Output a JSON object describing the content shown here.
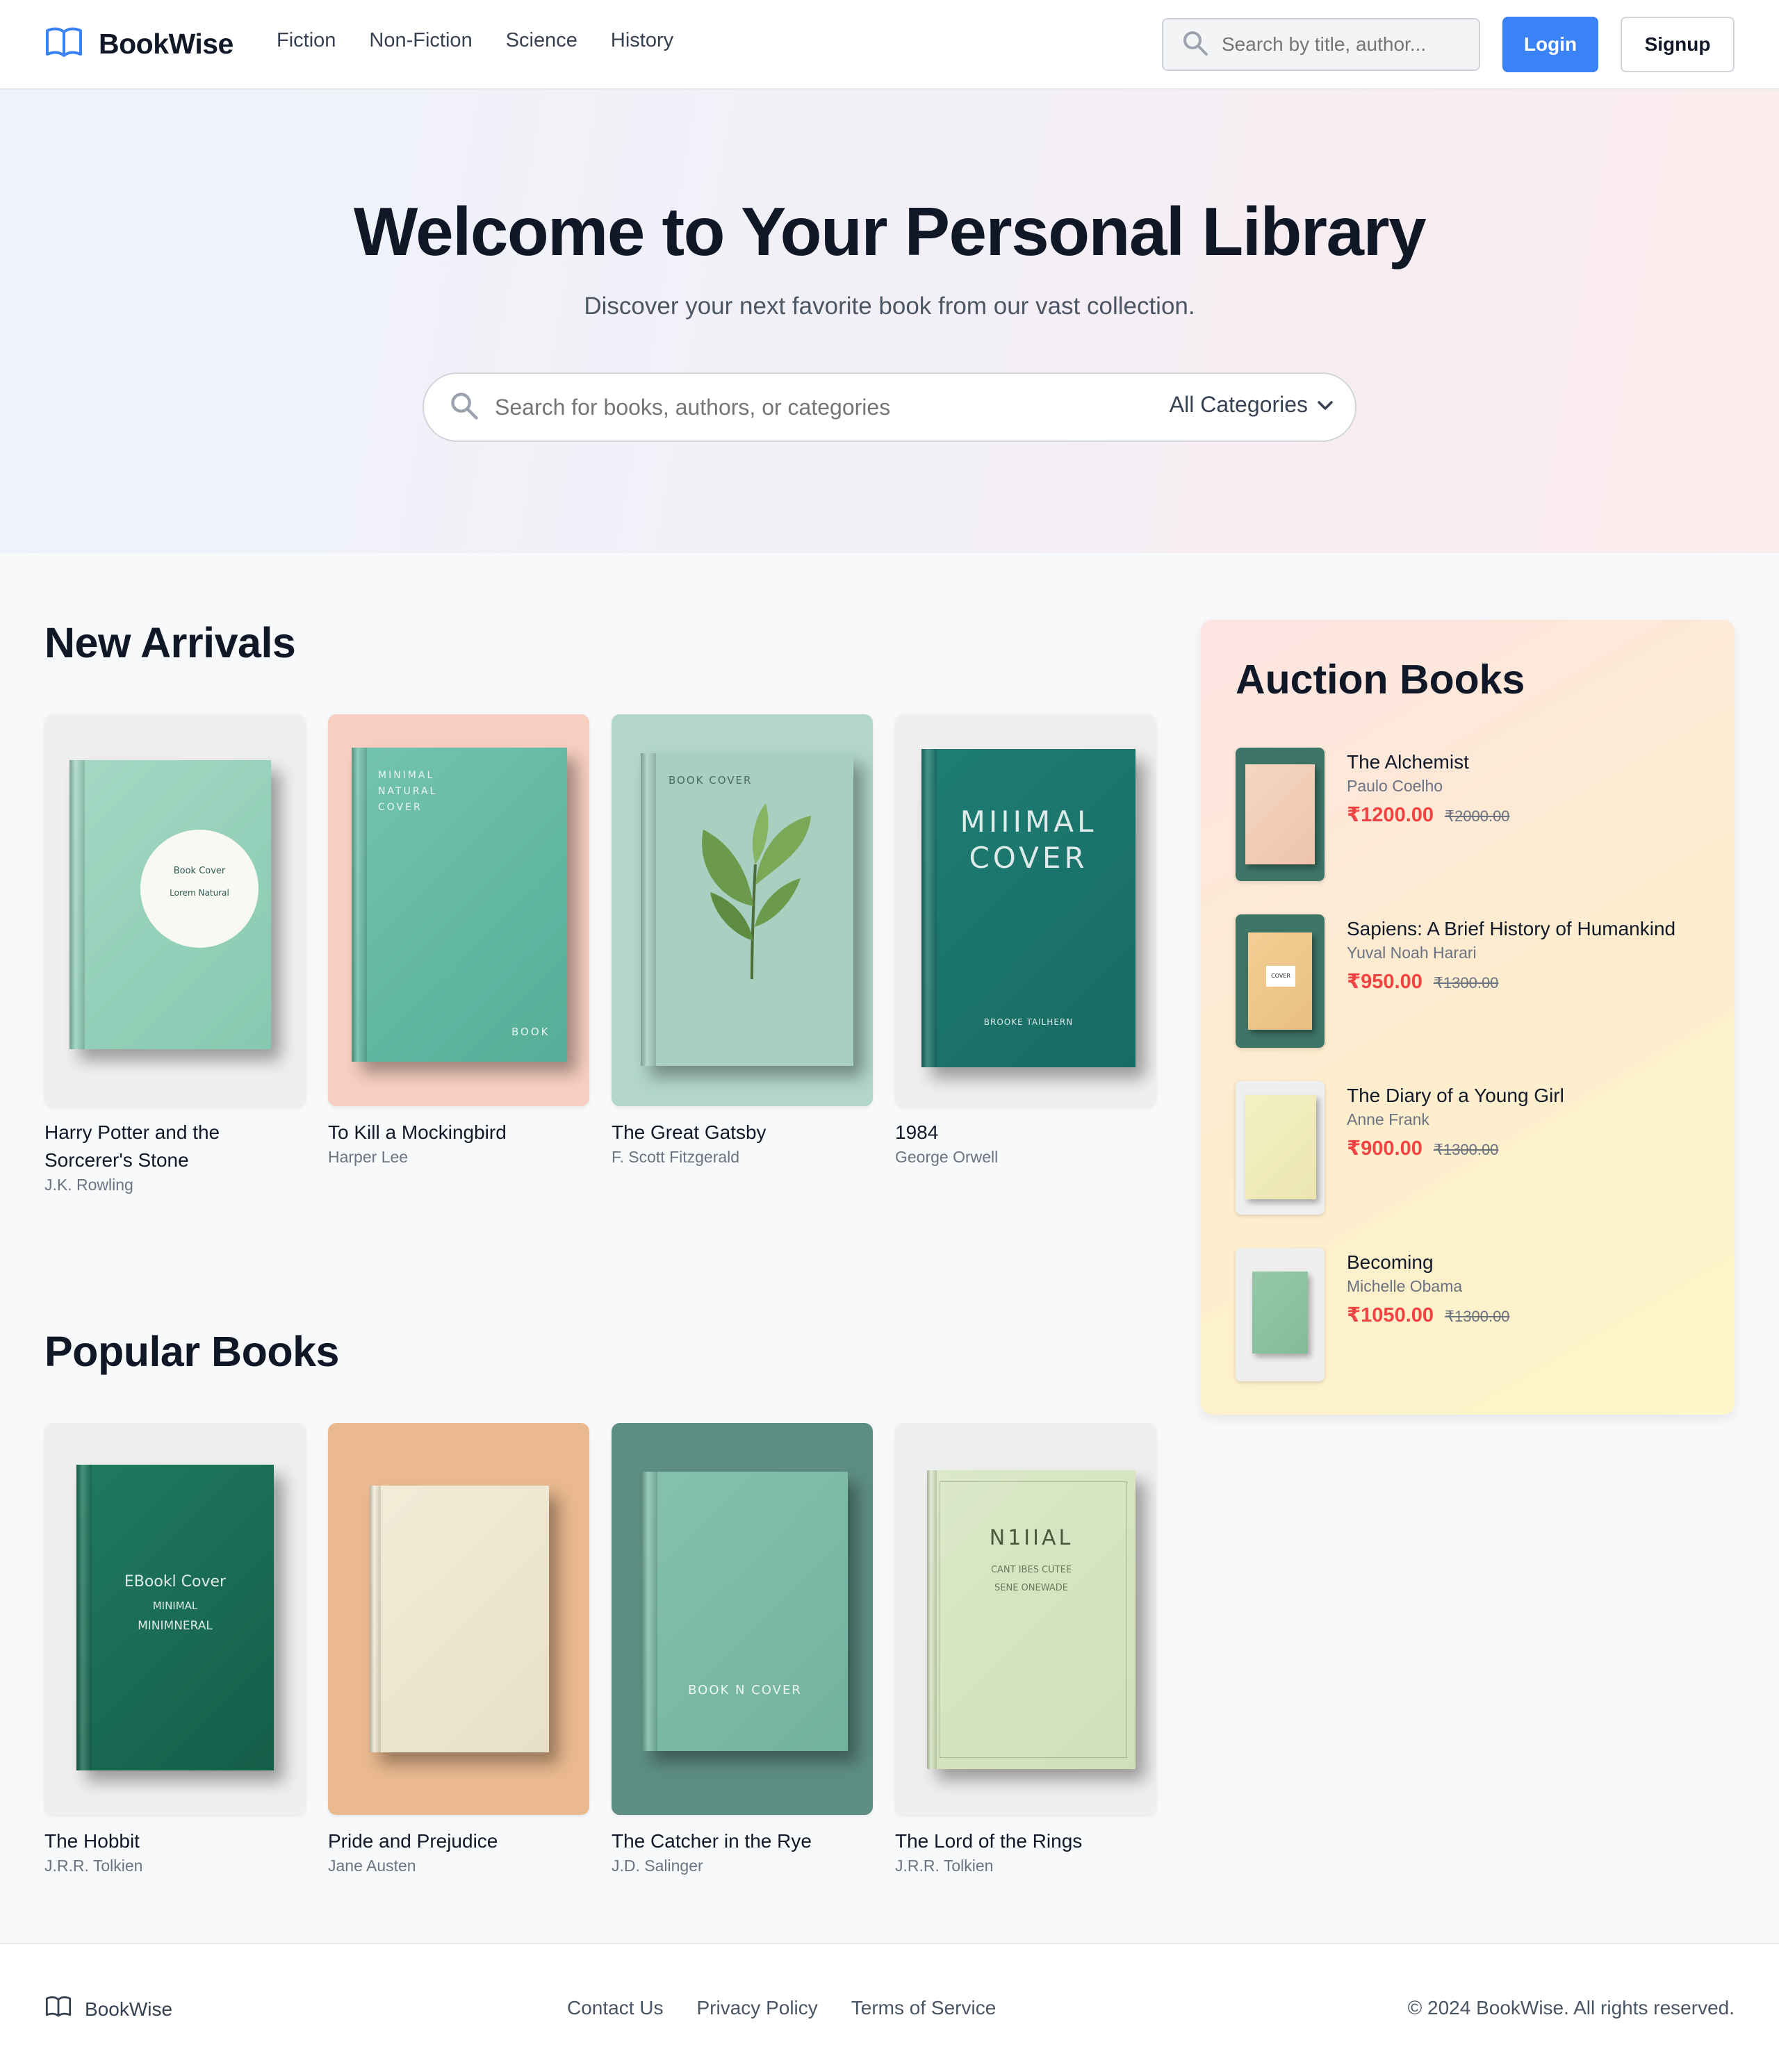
{
  "header": {
    "brand": "BookWise",
    "nav": [
      "Fiction",
      "Non-Fiction",
      "Science",
      "History"
    ],
    "search_placeholder": "Search by title, author...",
    "login_label": "Login",
    "signup_label": "Signup"
  },
  "hero": {
    "title": "Welcome to Your Personal Library",
    "subtitle": "Discover your next favorite book from our vast collection.",
    "search_placeholder": "Search for books, authors, or categories",
    "category_selected": "All Categories"
  },
  "new_arrivals": {
    "heading": "New Arrivals",
    "books": [
      {
        "title": "Harry Potter and the Sorcerer's Stone",
        "author": "J.K. Rowling"
      },
      {
        "title": "To Kill a Mockingbird",
        "author": "Harper Lee"
      },
      {
        "title": "The Great Gatsby",
        "author": "F. Scott Fitzgerald"
      },
      {
        "title": "1984",
        "author": "George Orwell"
      }
    ]
  },
  "popular": {
    "heading": "Popular Books",
    "books": [
      {
        "title": "The Hobbit",
        "author": "J.R.R. Tolkien"
      },
      {
        "title": "Pride and Prejudice",
        "author": "Jane Austen"
      },
      {
        "title": "The Catcher in the Rye",
        "author": "J.D. Salinger"
      },
      {
        "title": "The Lord of the Rings",
        "author": "J.R.R. Tolkien"
      }
    ]
  },
  "covers": {
    "c1": [
      "Book Cover",
      "Lorem Natural"
    ],
    "c2": [
      "MINIMAL",
      "NATURAL",
      "COVER",
      "BOOK"
    ],
    "c3": [
      "BOOK COVER"
    ],
    "c4": [
      "MIIIMAL",
      "COVER",
      "BROOKE TAILHERN"
    ],
    "p1": [
      "EBookl Cover",
      "MINIMAL",
      "MINIMNERAL"
    ],
    "p3": [
      "BOOK N COVER"
    ],
    "p4": [
      "N1IIAL",
      "CANT IBES CUTEE",
      "SENE ONEWADE"
    ],
    "a2": [
      "COVER"
    ]
  },
  "auction": {
    "heading": "Auction Books",
    "items": [
      {
        "title": "The Alchemist",
        "author": "Paulo Coelho",
        "price": "₹1200.00",
        "old_price": "₹2000.00"
      },
      {
        "title": "Sapiens: A Brief History of Humankind",
        "author": "Yuval Noah Harari",
        "price": "₹950.00",
        "old_price": "₹1300.00"
      },
      {
        "title": "The Diary of a Young Girl",
        "author": "Anne Frank",
        "price": "₹900.00",
        "old_price": "₹1300.00"
      },
      {
        "title": "Becoming",
        "author": "Michelle Obama",
        "price": "₹1050.00",
        "old_price": "₹1300.00"
      }
    ]
  },
  "footer": {
    "brand": "BookWise",
    "links": [
      "Contact Us",
      "Privacy Policy",
      "Terms of Service"
    ],
    "copyright": "© 2024 BookWise. All rights reserved."
  },
  "colors": {
    "accent": "#3b82f6",
    "price": "#ef4444",
    "text_dark": "#101828"
  }
}
